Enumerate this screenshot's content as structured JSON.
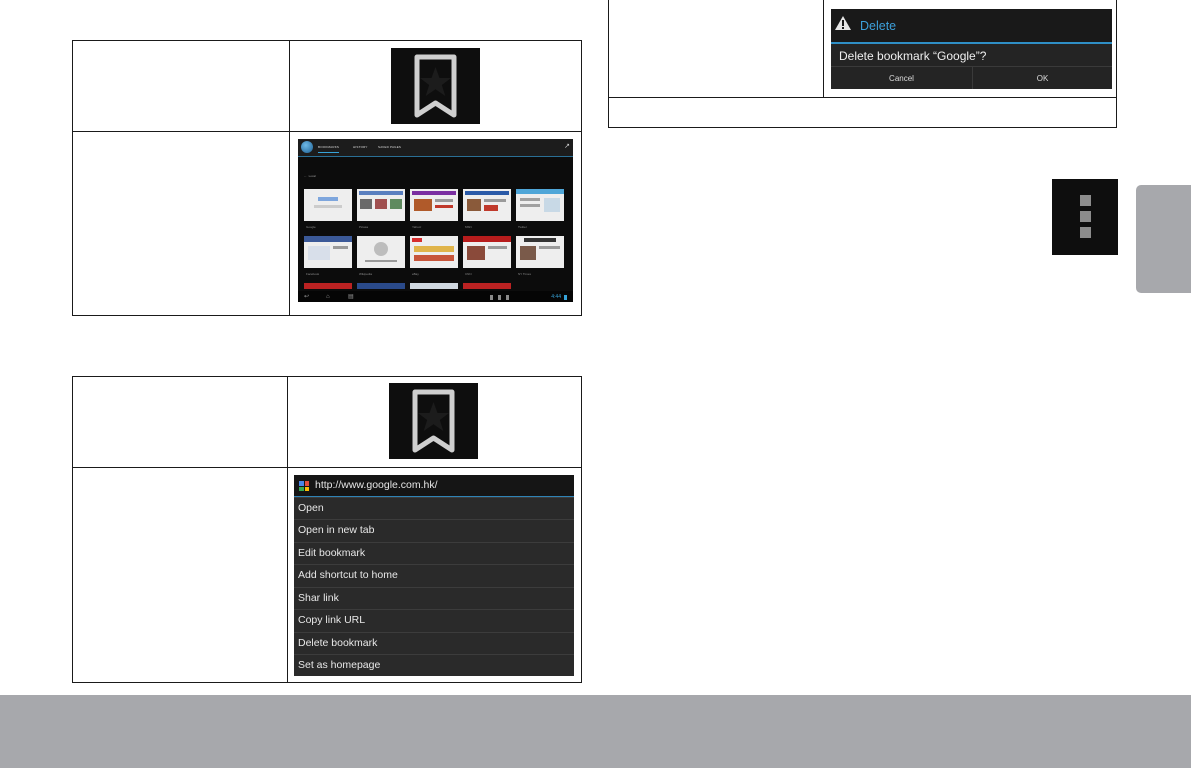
{
  "bookmarks_screen": {
    "tabs": [
      "BOOKMARKS",
      "HISTORY",
      "SAVED PAGES"
    ],
    "folder": "Local",
    "thumbs_row1": [
      "Google",
      "Picasa",
      "Yahoo!",
      "MSN",
      "Twitter"
    ],
    "thumbs_row2": [
      "Facebook",
      "Wikipedia",
      "eBay",
      "CNN",
      "NY Times"
    ],
    "clock": "4:44"
  },
  "context_menu": {
    "url": "http://www.google.com.hk/",
    "items": [
      "Open",
      "Open in new tab",
      "Edit bookmark",
      "Add shortcut to home",
      "Shar link",
      "Copy link URL",
      "Delete bookmark",
      "Set as homepage"
    ]
  },
  "delete_dialog": {
    "title": "Delete",
    "message": "Delete bookmark “Google”?",
    "cancel": "Cancel",
    "ok": "OK"
  },
  "icons": {
    "bookmark": "bookmark-star-icon",
    "overflow": "overflow-menu-icon",
    "warning": "warning-icon",
    "favicon": "google-favicon-icon"
  },
  "colors": {
    "accent_blue": "#36a3d9",
    "footer_gray": "#a7a8ac",
    "dialog_bg": "#242424",
    "menu_bg": "#2a2a2a"
  }
}
